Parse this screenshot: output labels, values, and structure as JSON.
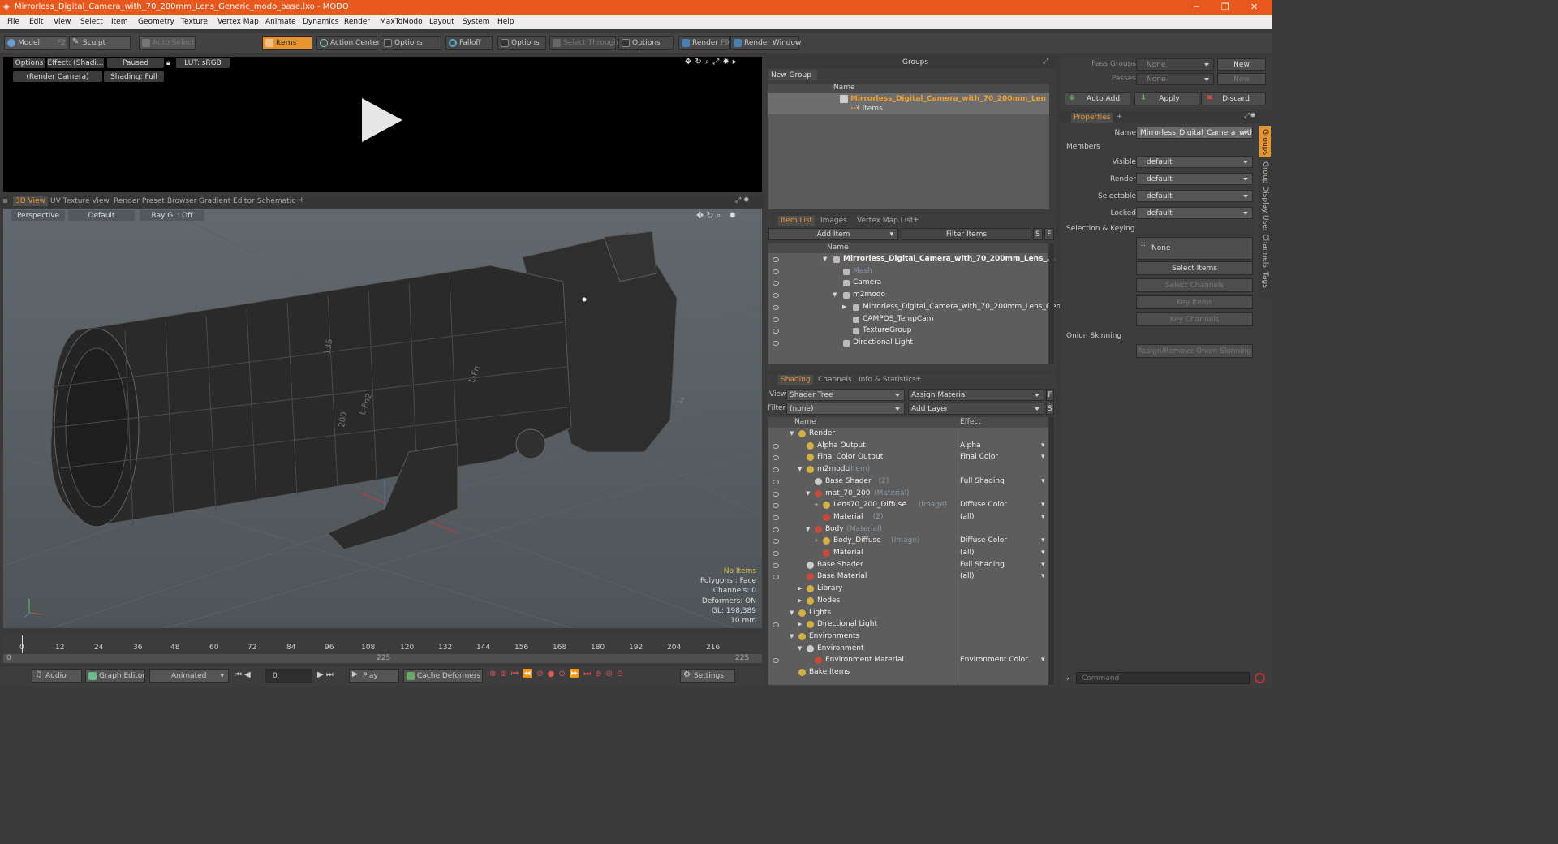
{
  "window": {
    "title": "Mirrorless_Digital_Camera_with_70_200mm_Lens_Generic_modo_base.lxo - MODO",
    "min": "─",
    "max": "❐",
    "close": "✕"
  },
  "menu": [
    "File",
    "Edit",
    "View",
    "Select",
    "Item",
    "Geometry",
    "Texture",
    "Vertex Map",
    "Animate",
    "Dynamics",
    "Render",
    "MaxToModo",
    "Layout",
    "System",
    "Help"
  ],
  "toolbar": {
    "model": "Model",
    "model_key": "F2",
    "sculpt": "Sculpt",
    "auto_select": "Auto Select",
    "items": "Items",
    "action_center": "Action Center",
    "options1": "Options",
    "falloff": "Falloff",
    "options2": "Options",
    "select_through": "Select Through",
    "options3": "Options",
    "render": "Render",
    "render_key": "F9",
    "render_window": "Render Window"
  },
  "preview": {
    "options": "Options",
    "effect": "Effect: (Shadi...",
    "paused": "Paused",
    "lut": "LUT: sRGB",
    "camera": "(Render Camera)",
    "shading": "Shading: Full"
  },
  "viewtabs": [
    "3D View",
    "UV Texture View",
    "Render Preset Browser",
    "Gradient Editor",
    "Schematic",
    "+"
  ],
  "viewport": {
    "perspective": "Perspective",
    "default": "Default",
    "raygl": "Ray GL: Off",
    "info": [
      "No Items",
      "Polygons : Face",
      "Channels: 0",
      "Deformers: ON",
      "GL: 198,389",
      "10 mm"
    ],
    "axis_label": "-Z",
    "lens_labels": [
      "L-Fn2",
      "200",
      "135",
      "L-Fn"
    ]
  },
  "timeline": {
    "ticks": [
      "0",
      "12",
      "24",
      "36",
      "48",
      "60",
      "72",
      "84",
      "96",
      "108",
      "120",
      "132",
      "144",
      "156",
      "168",
      "180",
      "192",
      "204",
      "216"
    ],
    "start": "0",
    "mid": "225",
    "end": "225"
  },
  "bottom": {
    "audio": "Audio",
    "graph_editor": "Graph Editor",
    "animated": "Animated",
    "frame": "0",
    "play": "Play",
    "cache": "Cache Deformers",
    "settings": "Settings"
  },
  "groups": {
    "title": "Groups",
    "new_group": "New Group",
    "col_name": "Name",
    "item_name": "Mirrorless_Digital_Camera_with_70_200mm_Len ...",
    "item_count": "3 Items"
  },
  "itemlist": {
    "tabs": [
      "Item List",
      "Images",
      "Vertex Map List",
      "+"
    ],
    "add_item": "Add Item",
    "filter": "Filter Items",
    "s": "S",
    "f": "F",
    "col_name": "Name",
    "rows": [
      {
        "label": "Mirrorless_Digital_Camera_with_70_200mm_Lens_...",
        "indent": 0,
        "bold": true,
        "arrow": "▼"
      },
      {
        "label": "Mesh",
        "indent": 1,
        "dim": true,
        "arrow": ""
      },
      {
        "label": "Camera",
        "indent": 1,
        "arrow": ""
      },
      {
        "label": "m2modo",
        "indent": 1,
        "arrow": "▼"
      },
      {
        "label": "Mirrorless_Digital_Camera_with_70_200mm_Lens_Generic",
        "indent": 2,
        "arrow": "▶"
      },
      {
        "label": "CAMPOS_TempCam",
        "indent": 2,
        "arrow": ""
      },
      {
        "label": "TextureGroup",
        "indent": 2,
        "arrow": ""
      },
      {
        "label": "Directional Light",
        "indent": 1,
        "arrow": ""
      }
    ]
  },
  "shading": {
    "tabs": [
      "Shading",
      "Channels",
      "Info & Statistics",
      "+"
    ],
    "view_label": "View",
    "view_value": "Shader Tree",
    "assign_material": "Assign Material",
    "filter_label": "Filter",
    "filter_value": "(none)",
    "add_layer": "Add Layer",
    "f": "F",
    "s": "S",
    "col_name": "Name",
    "col_effect": "Effect",
    "rows": [
      {
        "label": "Render",
        "sub": "",
        "effect": "",
        "indent": 0,
        "arrow": "▼"
      },
      {
        "label": "Alpha Output",
        "sub": "",
        "effect": "Alpha",
        "indent": 1,
        "arrow": ""
      },
      {
        "label": "Final Color Output",
        "sub": "",
        "effect": "Final Color",
        "indent": 1,
        "arrow": ""
      },
      {
        "label": "m2modo",
        "sub": "(Item)",
        "effect": "",
        "indent": 1,
        "arrow": "▼"
      },
      {
        "label": "Base Shader",
        "sub": "(2)",
        "effect": "Full Shading",
        "indent": 2,
        "arrow": ""
      },
      {
        "label": "mat_70_200",
        "sub": "(Material)",
        "effect": "",
        "indent": 2,
        "arrow": "▼"
      },
      {
        "label": "Lens70_200_Diffuse",
        "sub": "(Image)",
        "effect": "Diffuse Color",
        "indent": 3,
        "arrow": "+"
      },
      {
        "label": "Material",
        "sub": "(2)",
        "effect": "(all)",
        "indent": 3,
        "arrow": ""
      },
      {
        "label": "Body",
        "sub": "(Material)",
        "effect": "",
        "indent": 2,
        "arrow": "▼"
      },
      {
        "label": "Body_Diffuse",
        "sub": "(Image)",
        "effect": "Diffuse Color",
        "indent": 3,
        "arrow": "+"
      },
      {
        "label": "Material",
        "sub": "",
        "effect": "(all)",
        "indent": 3,
        "arrow": ""
      },
      {
        "label": "Base Shader",
        "sub": "",
        "effect": "Full Shading",
        "indent": 1,
        "arrow": ""
      },
      {
        "label": "Base Material",
        "sub": "",
        "effect": "(all)",
        "indent": 1,
        "arrow": ""
      },
      {
        "label": "Library",
        "sub": "",
        "effect": "",
        "indent": 1,
        "arrow": "▶"
      },
      {
        "label": "Nodes",
        "sub": "",
        "effect": "",
        "indent": 1,
        "arrow": "▶"
      },
      {
        "label": "Lights",
        "sub": "",
        "effect": "",
        "indent": 0,
        "arrow": "▼"
      },
      {
        "label": "Directional Light",
        "sub": "",
        "effect": "",
        "indent": 1,
        "arrow": "▶"
      },
      {
        "label": "Environments",
        "sub": "",
        "effect": "",
        "indent": 0,
        "arrow": "▼"
      },
      {
        "label": "Environment",
        "sub": "",
        "effect": "",
        "indent": 1,
        "arrow": "▼"
      },
      {
        "label": "Environment Material",
        "sub": "",
        "effect": "Environment Color",
        "indent": 2,
        "arrow": ""
      },
      {
        "label": "Bake Items",
        "sub": "",
        "effect": "",
        "indent": 0,
        "arrow": ""
      }
    ]
  },
  "props": {
    "pass_groups": "Pass Groups",
    "passes": "Passes",
    "none": "None",
    "new": "New",
    "auto_add": "Auto Add",
    "apply": "Apply",
    "discard": "Discard",
    "tab": "Properties",
    "plus": "+",
    "name_label": "Name",
    "name_value": "Mirrorless_Digital_Camera_with_70",
    "members": "Members",
    "visible": "Visible",
    "render": "Render",
    "selectable": "Selectable",
    "locked": "Locked",
    "default": "default",
    "sel_keying": "Selection & Keying",
    "select_items": "Select Items",
    "select_channels": "Select Channels",
    "key_items": "Key Items",
    "key_channels": "Key Channels",
    "onion": "Onion Skinning",
    "assign_onion": "Assign/Remove Onion Skinning",
    "side_tabs": [
      "Groups",
      "Group Display",
      "User Channels",
      "Tags"
    ],
    "command": "Command"
  },
  "colors": {
    "accent": "#e7952d",
    "titlebar": "#e8571c"
  }
}
